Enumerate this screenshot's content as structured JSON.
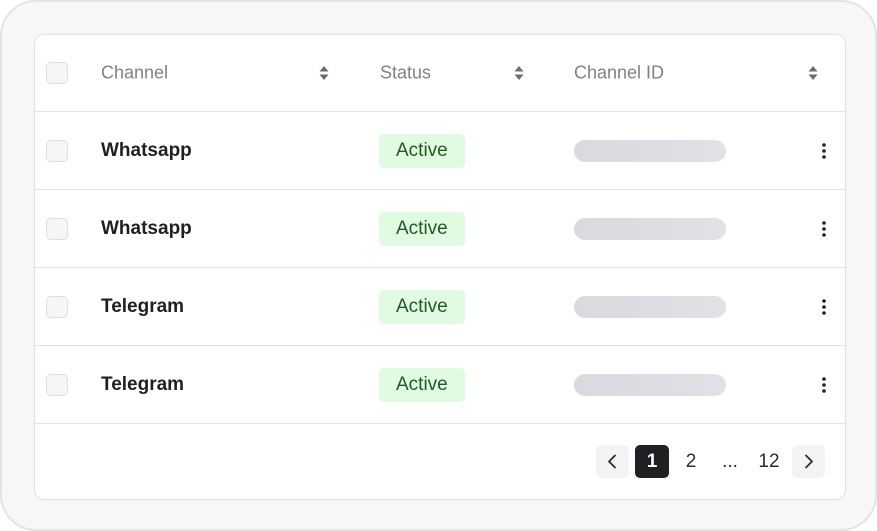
{
  "table": {
    "columns": {
      "channel": "Channel",
      "status": "Status",
      "channel_id": "Channel ID"
    },
    "rows": [
      {
        "channel": "Whatsapp",
        "status": "Active"
      },
      {
        "channel": "Whatsapp",
        "status": "Active"
      },
      {
        "channel": "Telegram",
        "status": "Active"
      },
      {
        "channel": "Telegram",
        "status": "Active"
      }
    ]
  },
  "pagination": {
    "current": "1",
    "next_page": "2",
    "ellipsis": "...",
    "last_page": "12"
  },
  "icons": {
    "sort": "sort-icon",
    "more": "more-vertical-icon",
    "prev": "chevron-left-icon",
    "next": "chevron-right-icon"
  },
  "colors": {
    "badge_bg": "#e1fbe2",
    "badge_text": "#1e5a22",
    "active_page_bg": "#202023"
  }
}
